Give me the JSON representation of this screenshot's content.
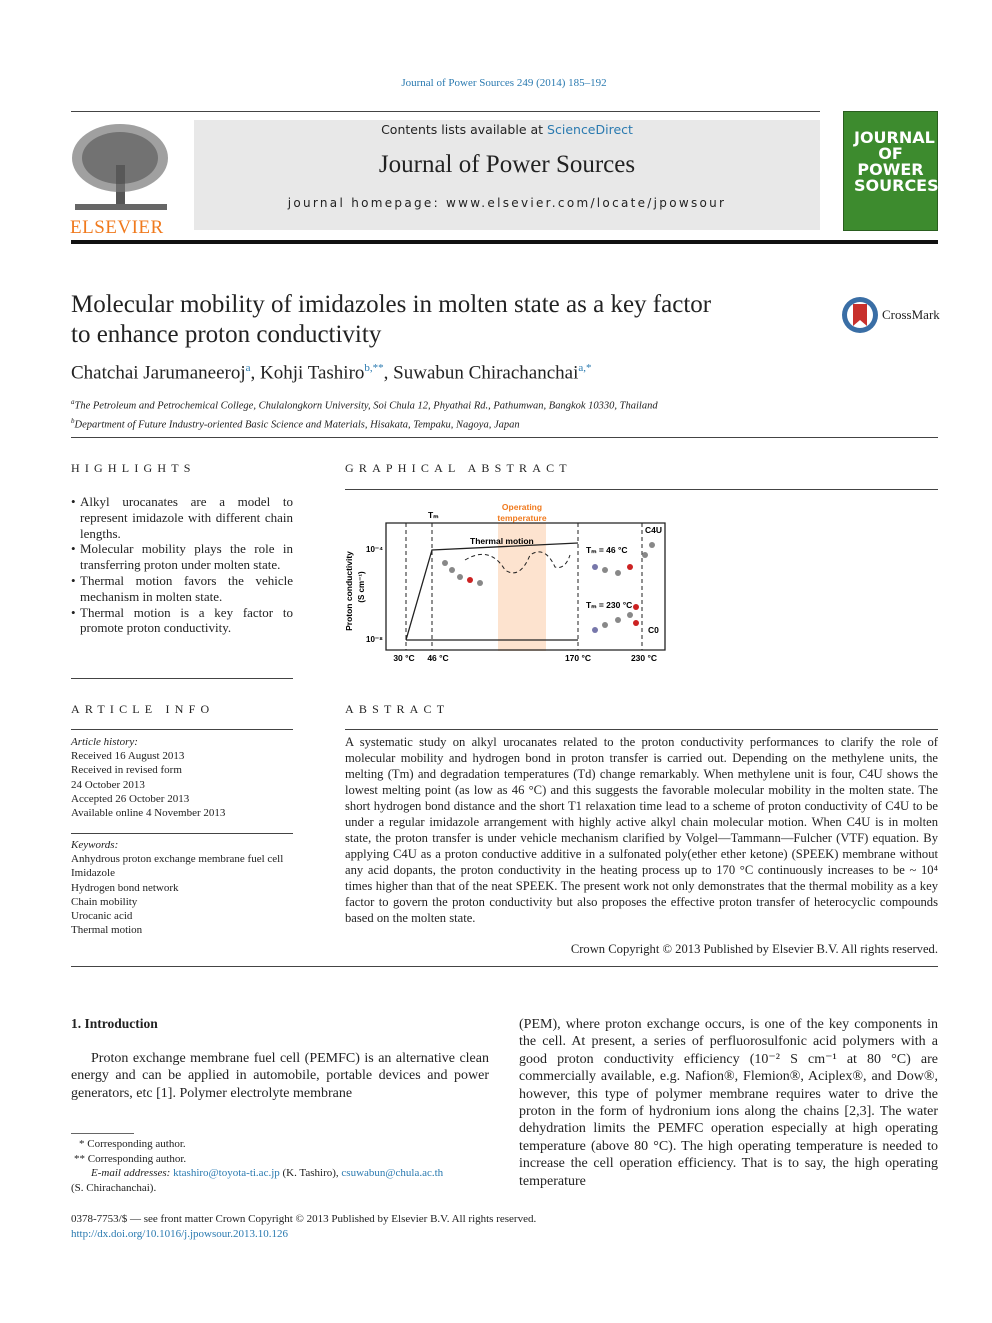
{
  "journal_ref": "Journal of Power Sources 249 (2014) 185–192",
  "header": {
    "contents_prefix": "Contents lists available at ",
    "contents_link": "ScienceDirect",
    "journal_title": "Journal of Power Sources",
    "homepage": "journal homepage: www.elsevier.com/locate/jpowsour",
    "publisher_logo": "ELSEVIER",
    "cover_text": "JOURNAL OF POWER SOURCES"
  },
  "crossmark": "CrossMark",
  "title_line1": "Molecular mobility of imidazoles in molten state as a key factor",
  "title_line2": "to enhance proton conductivity",
  "authors": [
    {
      "name": "Chatchai Jarumaneeroj",
      "sup": "a"
    },
    {
      "name": "Kohji Tashiro",
      "sup": "b,**"
    },
    {
      "name": "Suwabun Chirachanchai",
      "sup": "a,*"
    }
  ],
  "affiliations": [
    {
      "sup": "a",
      "text": "The Petroleum and Petrochemical College, Chulalongkorn University, Soi Chula 12, Phyathai Rd., Pathumwan, Bangkok 10330, Thailand"
    },
    {
      "sup": "b",
      "text": "Department of Future Industry-oriented Basic Science and Materials, Hisakata, Tempaku, Nagoya, Japan"
    }
  ],
  "highlights": {
    "heading": "HIGHLIGHTS",
    "items": [
      "Alkyl urocanates are a model to represent imidazole with different chain lengths.",
      "Molecular mobility plays the role in transferring proton under molten state.",
      "Thermal motion favors the vehicle mechanism in molten state.",
      "Thermal motion is a key factor to promote proton conductivity."
    ]
  },
  "graphical_abstract": {
    "heading": "GRAPHICAL ABSTRACT",
    "ylabel": "Proton conductivity",
    "yunit": "(S cm⁻¹)",
    "y_top": "10⁻⁴",
    "y_bottom": "10⁻⁸",
    "tm": "Tₘ",
    "operating1": "Operating",
    "operating2": "temperature",
    "thermal": "Thermal motion",
    "c4u": "C4U",
    "c0": "C0",
    "tm46": "Tₘ = 46 °C",
    "tm230": "Tₘ = 230 °C",
    "x_ticks": [
      "30 °C",
      "46 °C",
      "170 °C",
      "230 °C"
    ],
    "accent": "#f07a1e"
  },
  "article_info": {
    "heading": "ARTICLE INFO",
    "history_label": "Article history:",
    "history": [
      "Received 16 August 2013",
      "Received in revised form",
      "24 October 2013",
      "Accepted 26 October 2013",
      "Available online 4 November 2013"
    ],
    "keywords_label": "Keywords:",
    "keywords": [
      "Anhydrous proton exchange membrane fuel cell",
      "Imidazole",
      "Hydrogen bond network",
      "Chain mobility",
      "Urocanic acid",
      "Thermal motion"
    ]
  },
  "abstract": {
    "heading": "ABSTRACT",
    "text": "A systematic study on alkyl urocanates related to the proton conductivity performances to clarify the role of molecular mobility and hydrogen bond in proton transfer is carried out. Depending on the methylene units, the melting (Tm) and degradation temperatures (Td) change remarkably. When methylene unit is four, C4U shows the lowest melting point (as low as 46 °C) and this suggests the favorable molecular mobility in the molten state. The short hydrogen bond distance and the short T1 relaxation time lead to a scheme of proton conductivity of C4U to be under a regular imidazole arrangement with highly active alkyl chain molecular motion. When C4U is in molten state, the proton transfer is under vehicle mechanism clarified by Volgel—Tammann—Fulcher (VTF) equation. By applying C4U as a proton conductive additive in a sulfonated poly(ether ether ketone) (SPEEK) membrane without any acid dopants, the proton conductivity in the heating process up to 170 °C continuously increases to be ~ 10⁴ times higher than that of the neat SPEEK. The present work not only demonstrates that the thermal mobility as a key factor to govern the proton conductivity but also proposes the effective proton transfer of heterocyclic compounds based on the molten state.",
    "copyright": "Crown Copyright © 2013 Published by Elsevier B.V. All rights reserved."
  },
  "intro": {
    "heading": "1.  Introduction",
    "left": "Proton exchange membrane fuel cell (PEMFC) is an alternative clean energy and can be applied in automobile, portable devices and power generators, etc [1]. Polymer electrolyte membrane",
    "right": "(PEM), where proton exchange occurs, is one of the key components in the cell. At present, a series of perfluorosulfonic acid polymers with a good proton conductivity efficiency (10⁻² S cm⁻¹ at 80 °C) are commercially available, e.g. Nafion®, Flemion®, Aciplex®, and Dow®, however, this type of polymer membrane requires water to drive the proton in the form of hydronium ions along the chains [2,3]. The water dehydration limits the PEMFC operation especially at high operating temperature (above 80 °C). The high operating temperature is needed to increase the cell operation efficiency. That is to say, the high operating temperature"
  },
  "footnotes": {
    "star1": "* Corresponding author.",
    "star2": "** Corresponding author.",
    "email_label": "E-mail addresses:",
    "email1": "ktashiro@toyota-ti.ac.jp",
    "email1_who": "(K. Tashiro),",
    "email2": "csuwabun@chula.ac.th",
    "email2_who": "(S. Chirachanchai)."
  },
  "footer": {
    "issn": "0378-7753/$ — see front matter Crown Copyright © 2013 Published by Elsevier B.V. All rights reserved.",
    "doi": "http://dx.doi.org/10.1016/j.jpowsour.2013.10.126"
  }
}
